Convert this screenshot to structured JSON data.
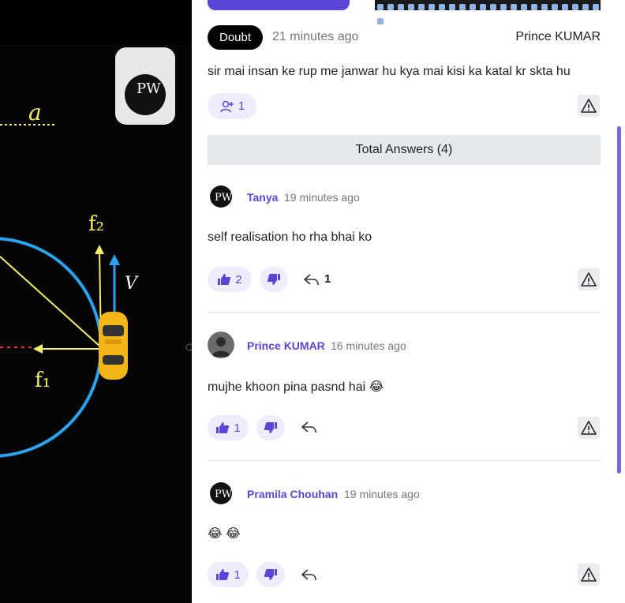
{
  "question": {
    "badge": "Doubt",
    "time": "21 minutes ago",
    "author": "Prince KUMAR",
    "text": "sir mai insan ke rup me janwar hu kya mai kisi ka katal kr skta hu",
    "follow_count": "1"
  },
  "answers_header": "Total Answers (4)",
  "answers": [
    {
      "name": "Tanya",
      "time": "19 minutes ago",
      "text": "self realisation ho rha bhai ko",
      "likes": "2",
      "replies": "1"
    },
    {
      "name": "Prince KUMAR",
      "time": "16 minutes ago",
      "text": "mujhe khoon pina pasnd hai",
      "emoji": "😂",
      "likes": "1",
      "replies": ""
    },
    {
      "name": "Pramila Chouhan",
      "time": "19 minutes ago",
      "text": "😂 😂",
      "likes": "1",
      "replies": ""
    }
  ],
  "video": {
    "labels": {
      "f2": "f₂",
      "f1": "f₁",
      "v": "V",
      "a": "a",
      "logo": "PW"
    }
  },
  "colors": {
    "accent": "#5b45d6",
    "pill_bg": "#efedfb",
    "bar_bg": "#e7e8ec",
    "circle": "#2ba3ef",
    "chalk": "#f4ef6a"
  },
  "icons": [
    "add-user-icon",
    "warning-icon",
    "thumbs-up-icon",
    "thumbs-down-icon",
    "reply-icon"
  ]
}
